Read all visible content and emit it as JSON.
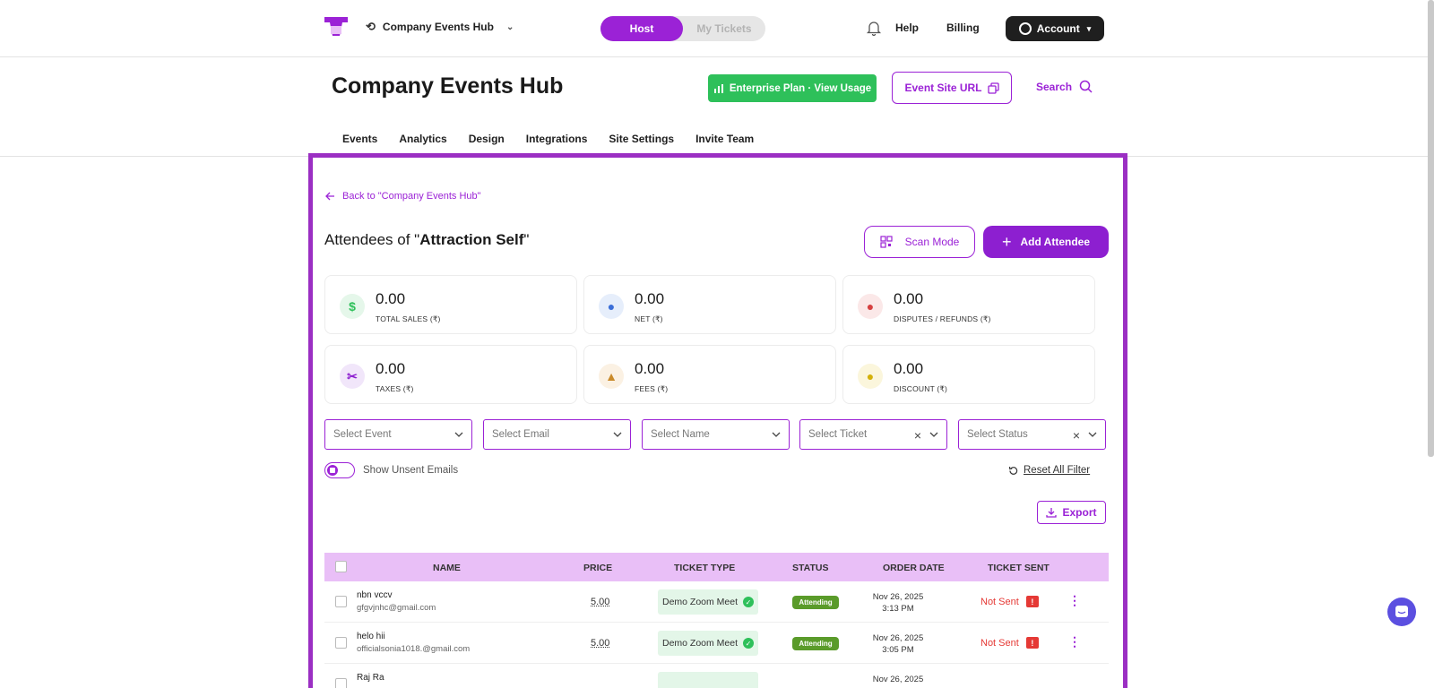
{
  "topbar": {
    "org_name": "Company Events Hub",
    "modes": [
      "Host",
      "My Tickets"
    ],
    "help": "Help",
    "billing": "Billing",
    "account": "Account"
  },
  "header": {
    "title": "Company Events Hub",
    "plan_button": "Enterprise Plan · View Usage",
    "site_url_button": "Event Site URL",
    "search": "Search"
  },
  "tabs": [
    "Events",
    "Analytics",
    "Design",
    "Integrations",
    "Site Settings",
    "Invite Team"
  ],
  "attendees": {
    "back_link": "Back to \"Company Events Hub\"",
    "title_prefix": "Attendees of \"",
    "event_name": "Attraction Self",
    "title_suffix": "\"",
    "scan_mode": "Scan Mode",
    "add_attendee": "Add Attendee"
  },
  "stats": [
    {
      "value": "0.00",
      "label": "TOTAL SALES (₹)",
      "icon": "dollar-icon",
      "color": "#2ec05a",
      "bg": "#e5f7ea"
    },
    {
      "value": "0.00",
      "label": "NET (₹)",
      "icon": "money-bag-icon",
      "color": "#3b6fd8",
      "bg": "#e6eefb"
    },
    {
      "value": "0.00",
      "label": "DISPUTES / REFUNDS (₹)",
      "icon": "refund-icon",
      "color": "#d64040",
      "bg": "#fbe8e8"
    },
    {
      "value": "0.00",
      "label": "TAXES (₹)",
      "icon": "scissors-icon",
      "color": "#8d1fd0",
      "bg": "#f1e6fa"
    },
    {
      "value": "0.00",
      "label": "FEES (₹)",
      "icon": "hand-coin-icon",
      "color": "#c98a2a",
      "bg": "#fbf1e3"
    },
    {
      "value": "0.00",
      "label": "DISCOUNT (₹)",
      "icon": "discount-coin-icon",
      "color": "#d4b10a",
      "bg": "#fbf6dc"
    }
  ],
  "filters": {
    "event": "Select Event",
    "email": "Select Email",
    "name": "Select Name",
    "ticket": "Select Ticket",
    "status": "Select Status",
    "show_unsent": "Show Unsent Emails",
    "reset": "Reset All Filter"
  },
  "table": {
    "export": "Export",
    "columns": [
      "NAME",
      "PRICE",
      "TICKET TYPE",
      "STATUS",
      "ORDER DATE",
      "TICKET SENT"
    ],
    "rows": [
      {
        "name": "nbn vccv",
        "email": "gfgvjnhc@gmail.com",
        "price": "5.00",
        "ticket_type": "Demo Zoom Meet",
        "status": "Attending",
        "date": "Nov 26, 2025",
        "time": "3:13 PM",
        "sent": "Not Sent"
      },
      {
        "name": "helo hii",
        "email": "officialsonia1018.@gmail.com",
        "price": "5.00",
        "ticket_type": "Demo Zoom Meet",
        "status": "Attending",
        "date": "Nov 26, 2025",
        "time": "3:05 PM",
        "sent": "Not Sent"
      },
      {
        "name": "Raj Ra",
        "email": "",
        "price": "",
        "ticket_type": "",
        "status": "",
        "date": "Nov 26, 2025",
        "time": "",
        "sent": ""
      }
    ]
  }
}
